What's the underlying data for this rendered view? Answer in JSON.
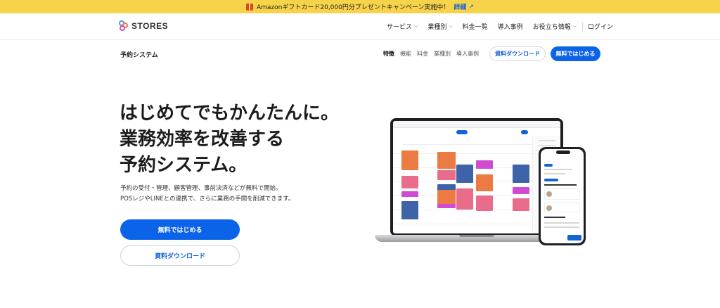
{
  "promo": {
    "text": "Amazonギフトカード20,000円分プレゼントキャンペーン実施中！",
    "detail": "詳細",
    "arrow": "↗",
    "color": "#f7d34a"
  },
  "header": {
    "logo": "STORES",
    "nav": [
      {
        "label": "サービス",
        "chevron": "⌵"
      },
      {
        "label": "業種別",
        "chevron": "⌵"
      },
      {
        "label": "料金一覧"
      },
      {
        "label": "導入事例"
      },
      {
        "label": "お役立ち情報",
        "chevron": "⌵"
      }
    ],
    "login": "ログイン"
  },
  "subbar": {
    "product": "予約システム",
    "links": [
      "特徴",
      "機能",
      "料金",
      "業種別",
      "導入事例"
    ],
    "download": "資料ダウンロード",
    "start": "無料ではじめる"
  },
  "hero": {
    "headline": [
      "はじめてでもかんたんに。",
      "業務効率を改善する",
      "予約システム。"
    ],
    "desc": [
      "予約の受付・管理、顧客管理、事前決済などが無料で開始。",
      "POSレジやLINEとの連携で、さらに業務の手間を削減できます。"
    ],
    "primary": "無料ではじめる",
    "secondary": "資料ダウンロード"
  },
  "colors": {
    "accent": "#0a63e9",
    "link": "#1463d6",
    "event_orange": "#ec7a43",
    "event_blue": "#3e63a8",
    "event_pink": "#e96c8a",
    "event_magenta": "#d04bd2"
  }
}
